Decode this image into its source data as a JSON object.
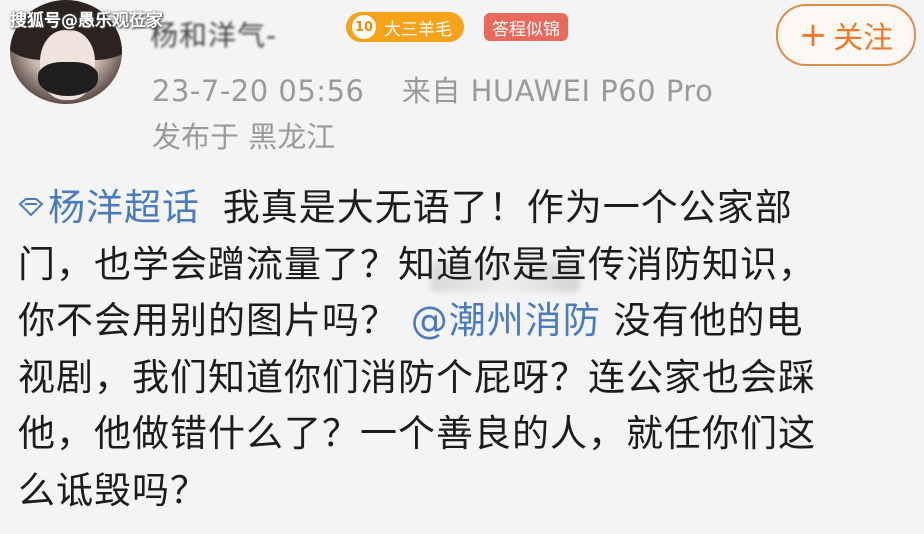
{
  "watermark": "搜狐号@愚乐观莅家",
  "user": {
    "name_blurred": "杨和洋气-",
    "level": "10",
    "level_label": "大三羊毛",
    "tag": "答程似锦",
    "follow_label": "关注"
  },
  "meta": {
    "timestamp": "23-7-20 05:56",
    "from_label": "来自",
    "device": "HUAWEI P60 Pro",
    "location": "发布于 黑龙江"
  },
  "post": {
    "topic": "杨洋超话",
    "lines": [
      "我真是大无语了！作为一个公家部",
      "门，也学会蹭流量了？知道你是宣传消防知识，",
      "你不会用别的图片吗？",
      "没有他的电",
      "视剧，我们知道你们消防个屁呀？连公家也会踩",
      "他，他做错什么了？一个善良的人，就任你们这",
      "么诋毁吗？"
    ],
    "mention": "@潮州消防"
  },
  "colors": {
    "link": "#4a7bbd",
    "follow": "#ea7a2c",
    "badge_level": "#f7a21b",
    "badge_tag": "#e96a5d"
  }
}
